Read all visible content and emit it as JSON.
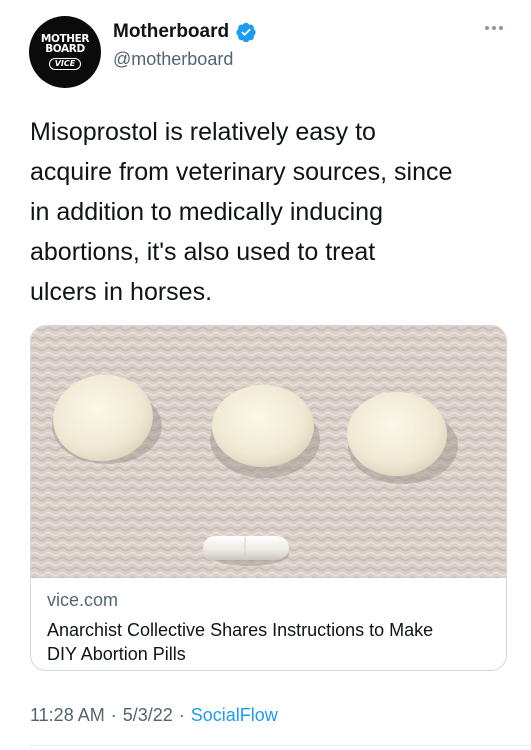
{
  "author": {
    "display_name": "Motherboard",
    "handle": "@motherboard",
    "avatar_text_line1": "MOTHER",
    "avatar_text_line2": "BOARD",
    "avatar_text_brand": "VICE",
    "verified": true
  },
  "tweet": {
    "text": "Misoprostol is relatively easy to\nacquire from veterinary sources, since\nin addition to medically inducing\nabortions, it's also used to treat\nulcers in horses."
  },
  "link_card": {
    "domain": "vice.com",
    "title": "Anarchist Collective Shares Instructions to Make\nDIY Abortion Pills",
    "image": "photo of three white round pills and one capsule on a textured white cloth"
  },
  "footer": {
    "time": "11:28 AM",
    "date": "5/3/22",
    "source": "SocialFlow",
    "separator": "·"
  },
  "icons": {
    "verified_badge": "verified-badge-icon",
    "more": "more-options-icon"
  },
  "colors": {
    "verified_blue": "#1d9bf0",
    "secondary_text": "#536471",
    "primary_text": "#0f1419"
  }
}
